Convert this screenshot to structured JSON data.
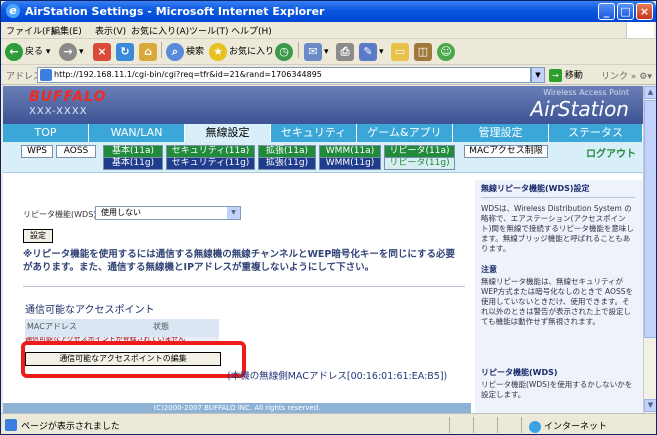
{
  "window": {
    "title": "AirStation Settings - Microsoft Internet Explorer"
  },
  "menu": [
    "ファイル(F)",
    "編集(E)",
    "表示(V)",
    "お気に入り(A)",
    "ツール(T)",
    "ヘルプ(H)"
  ],
  "toolbar": {
    "back": "戻る",
    "search": "検索",
    "favorites": "お気に入り"
  },
  "address": {
    "label": "アドレス(D)",
    "url": "http://192.168.11.1/cgi-bin/cgi?req=tfr&id=21&rand=1706344895",
    "go": "移動",
    "links": "リンク"
  },
  "header": {
    "brand": "BUFFALO",
    "model": "XXX-XXXX",
    "subtitle": "Wireless Access Point",
    "product": "AirStation"
  },
  "tabs": [
    "TOP",
    "WAN/LAN",
    "無線設定",
    "セキュリティ",
    "ゲーム&アプリ",
    "管理設定",
    "ステータス"
  ],
  "subnav": {
    "wps": "WPS",
    "aoss": "AOSS",
    "row1": [
      "基本(11a)",
      "セキュリティ(11a)",
      "拡張(11a)",
      "WMM(11a)",
      "リピータ(11a)"
    ],
    "row2": [
      "基本(11g)",
      "セキュリティ(11g)",
      "拡張(11g)",
      "WMM(11g)",
      "リピータ(11g)"
    ],
    "mac": "MACアクセス制限",
    "logout": "ログアウト"
  },
  "main": {
    "repeater_label": "リピータ機能(WDS)",
    "repeater_value": "使用しない",
    "set_button": "設定",
    "note": "※リピータ機能を使用するには通信する無線機の無線チャンネルとWEP暗号化キーを同じにする必要があります。また、通信する無線機とIPアドレスが重複しないようにして下さい。",
    "ap_title": "通信可能なアクセスポイント",
    "col_mac": "MACアドレス",
    "col_state": "状態",
    "ap_row_text": "通信可能なアクセスポイントが登録されていません",
    "edit_button": "通信可能なアクセスポイントの編集",
    "mac_line": "(本機の無線側MACアドレス[00:16:01:61:EA:B5])",
    "copyright": "(C)2000-2007 BUFFALO INC. All rights reserved."
  },
  "help": {
    "h1": "無線リピータ機能(WDS)設定",
    "t1": "WDSは、Wireless Distribution System の略称で、エアステーション(アクセスポイント)間を無線で接続するリピータ機能を意味します。無線ブリッジ機能と呼ばれることもあります。",
    "h2": "注意",
    "t2": "無線リピータ機能は、無線セキュリティがWEP方式または暗号化なしのときで AOSSを使用していないときだけ、使用できます。それ以外のときは警告が表示された上で設定しても機能は動作せず無視されます。",
    "h3": "リピータ機能(WDS)",
    "t3": "リピータ機能(WDS)を使用するかしないかを設定します。"
  },
  "status": {
    "text": "ページが表示されました",
    "zone": "インターネット"
  }
}
